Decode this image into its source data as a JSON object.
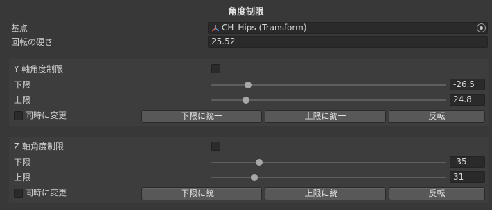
{
  "title": "角度制限",
  "base_point": {
    "label": "基点",
    "value": "CH_Hips (Transform)"
  },
  "stiffness": {
    "label": "回転の硬さ",
    "value": "25.52"
  },
  "y_axis": {
    "header": "Y 軸角度制限",
    "lower": {
      "label": "下限",
      "value": "-26.5",
      "fraction": 0.156
    },
    "upper": {
      "label": "上限",
      "value": "24.8",
      "fraction": 0.147
    },
    "sync_label": "同時に変更",
    "buttons": {
      "unify_lower": "下限に統一",
      "unify_upper": "上限に統一",
      "invert": "反転"
    }
  },
  "z_axis": {
    "header": "Z 軸角度制限",
    "lower": {
      "label": "下限",
      "value": "-35",
      "fraction": 0.204
    },
    "upper": {
      "label": "上限",
      "value": "31",
      "fraction": 0.183
    },
    "sync_label": "同時に変更",
    "buttons": {
      "unify_lower": "下限に統一",
      "unify_upper": "上限に統一",
      "invert": "反転"
    }
  }
}
